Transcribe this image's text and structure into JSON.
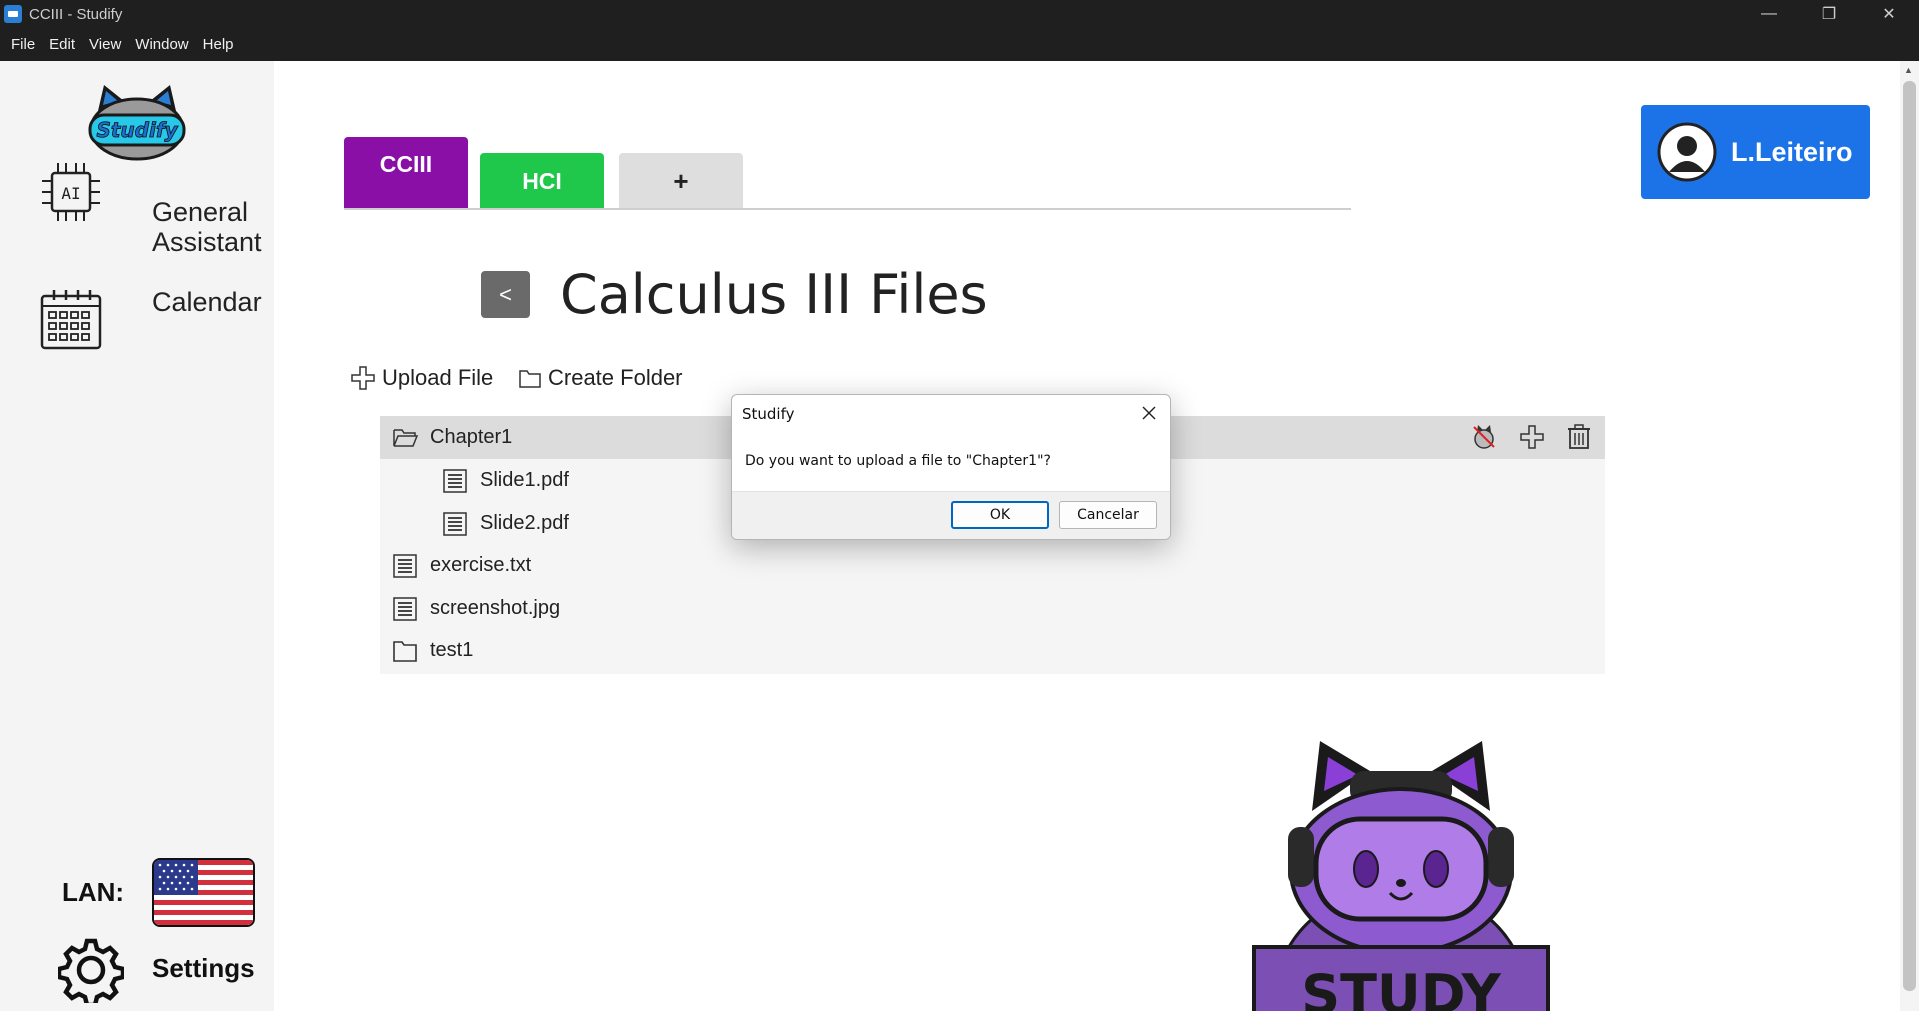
{
  "window": {
    "title": "CCIII - Studify",
    "minimize": "—",
    "restore": "❐",
    "close": "✕"
  },
  "menu": [
    "File",
    "Edit",
    "View",
    "Window",
    "Help"
  ],
  "sidebar": {
    "logo_text": "Studify",
    "assistant_label_line1": "General",
    "assistant_label_line2": "Assistant",
    "calendar_label": "Calendar",
    "lan_label": "LAN:",
    "settings_label": "Settings"
  },
  "tabs": [
    {
      "label": "CCIII",
      "color": "#8a0fa6"
    },
    {
      "label": "HCI",
      "color": "#1fc84a"
    },
    {
      "label": "+",
      "color": "#dedede"
    }
  ],
  "user": {
    "name": "L.Leiteiro"
  },
  "page": {
    "back_label": "<",
    "title": "Calculus III Files"
  },
  "actions": {
    "upload": "Upload File",
    "create_folder": "Create Folder"
  },
  "files": [
    {
      "name": "Chapter1",
      "type": "folder-open",
      "selected": true
    },
    {
      "name": "Slide1.pdf",
      "type": "file"
    },
    {
      "name": "Slide2.pdf",
      "type": "file"
    },
    {
      "name": "exercise.txt",
      "type": "file"
    },
    {
      "name": "screenshot.jpg",
      "type": "file"
    },
    {
      "name": "test1",
      "type": "folder"
    }
  ],
  "mascot_sign": "STUDY",
  "dialog": {
    "title": "Studify",
    "message": "Do you want to upload a file to \"Chapter1\"?",
    "ok": "OK",
    "cancel": "Cancelar"
  },
  "colors": {
    "accent": "#1c73e8",
    "cciii": "#8a0fa6",
    "hci": "#1fc84a",
    "titlebar": "#1f1f1f"
  }
}
